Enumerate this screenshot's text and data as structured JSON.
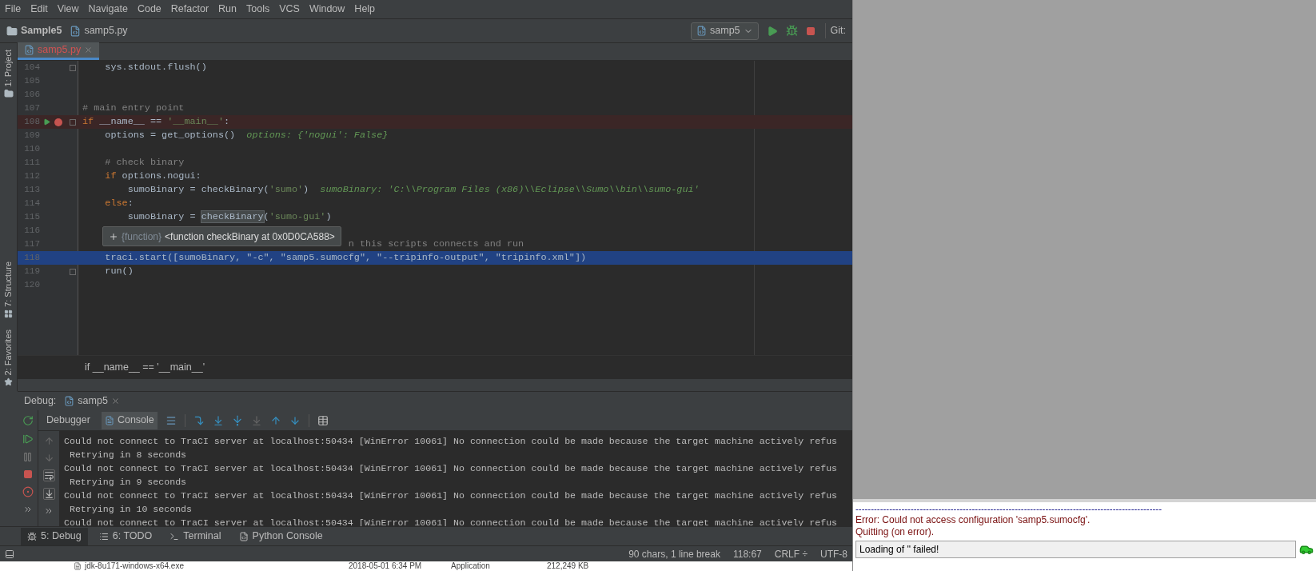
{
  "menu": [
    "File",
    "Edit",
    "View",
    "Navigate",
    "Code",
    "Refactor",
    "Run",
    "Tools",
    "VCS",
    "Window",
    "Help"
  ],
  "breadcrumb": [
    {
      "label": "Sample5",
      "kind": "folder"
    },
    {
      "label": "samp5.py",
      "kind": "file"
    }
  ],
  "run_config": "samp5",
  "toolbar_cut": "Git:",
  "editor_tabs": [
    {
      "label": "samp5.py",
      "selected": true
    }
  ],
  "side_tabs_top": [
    {
      "label": "1: Project",
      "kind": "folder"
    }
  ],
  "side_tabs_bottom": [
    {
      "label": "7: Structure",
      "kind": "structure"
    },
    {
      "label": "2: Favorites",
      "kind": "star"
    }
  ],
  "code_lines": [
    {
      "number": "104",
      "fold": true,
      "breakpoint": false,
      "run_marker": false,
      "selected": false,
      "tokens": [
        {
          "kind": "plain",
          "text": "    sys.stdout.flush()"
        }
      ]
    },
    {
      "number": "105",
      "fold": false,
      "breakpoint": false,
      "run_marker": false,
      "selected": false
    },
    {
      "number": "106",
      "fold": false,
      "breakpoint": false,
      "run_marker": false,
      "selected": false
    },
    {
      "number": "107",
      "fold": false,
      "breakpoint": false,
      "run_marker": false,
      "selected": false,
      "tokens": [
        {
          "kind": "comment",
          "text": "# main entry point"
        }
      ]
    },
    {
      "number": "108",
      "fold": true,
      "breakpoint": true,
      "run_marker": true,
      "selected": false,
      "tokens": [
        {
          "kind": "keyword",
          "text": "if "
        },
        {
          "kind": "plain",
          "text": "__name__ == "
        },
        {
          "kind": "string",
          "text": "'__main__'"
        },
        {
          "kind": "plain",
          "text": ":"
        }
      ]
    },
    {
      "number": "109",
      "fold": false,
      "breakpoint": false,
      "run_marker": false,
      "selected": false,
      "tokens": [
        {
          "kind": "plain",
          "text": "    options = get_options()"
        },
        {
          "kind": "hint",
          "text": "options: {'nogui': False}"
        }
      ]
    },
    {
      "number": "110",
      "fold": false,
      "breakpoint": false,
      "run_marker": false,
      "selected": false
    },
    {
      "number": "111",
      "fold": false,
      "breakpoint": false,
      "run_marker": false,
      "selected": false,
      "tokens": [
        {
          "kind": "comment",
          "text": "    # check binary"
        }
      ]
    },
    {
      "number": "112",
      "fold": false,
      "breakpoint": false,
      "run_marker": false,
      "selected": false,
      "tokens": [
        {
          "kind": "keyword",
          "text": "    if "
        },
        {
          "kind": "plain",
          "text": "options.nogui:"
        }
      ]
    },
    {
      "number": "113",
      "fold": false,
      "breakpoint": false,
      "run_marker": false,
      "selected": false,
      "tokens": [
        {
          "kind": "plain",
          "text": "        sumoBinary = checkBinary("
        },
        {
          "kind": "string",
          "text": "'sumo'"
        },
        {
          "kind": "plain",
          "text": ")"
        },
        {
          "kind": "hint",
          "text": "sumoBinary: 'C:\\\\Program Files (x86)\\\\Eclipse\\\\Sumo\\\\bin\\\\sumo-gui'"
        }
      ]
    },
    {
      "number": "114",
      "fold": false,
      "breakpoint": false,
      "run_marker": false,
      "selected": false,
      "tokens": [
        {
          "kind": "keyword",
          "text": "    else"
        },
        {
          "kind": "plain",
          "text": ":"
        }
      ]
    },
    {
      "number": "115",
      "fold": false,
      "breakpoint": false,
      "run_marker": false,
      "selected": false,
      "tokens": [
        {
          "kind": "plain",
          "text": "        sumoBinary = "
        },
        {
          "kind": "hover",
          "text": "checkBinary"
        },
        {
          "kind": "plain",
          "text": "("
        },
        {
          "kind": "string",
          "text": "'sumo-gui'"
        },
        {
          "kind": "plain",
          "text": ")"
        }
      ]
    },
    {
      "number": "116",
      "fold": false,
      "breakpoint": false,
      "run_marker": false,
      "selected": false
    },
    {
      "number": "117",
      "fold": false,
      "breakpoint": false,
      "run_marker": false,
      "selected": false,
      "tokens": [
        {
          "kind": "covered_comment",
          "text": "n this scripts connects and run"
        }
      ]
    },
    {
      "number": "118",
      "fold": false,
      "breakpoint": false,
      "run_marker": false,
      "selected": true,
      "tokens": [
        {
          "kind": "plain",
          "text": "    traci.start([sumoBinary, \"-c\", \"samp5.sumocfg\", \"--tripinfo-output\", \"tripinfo.xml\"])"
        }
      ]
    },
    {
      "number": "119",
      "fold": true,
      "breakpoint": false,
      "run_marker": false,
      "selected": false,
      "tokens": [
        {
          "kind": "plain",
          "text": "    run()"
        }
      ]
    },
    {
      "number": "120",
      "fold": false,
      "breakpoint": false,
      "run_marker": false,
      "selected": false
    }
  ],
  "tooltip": {
    "type": "{function}",
    "value": "<function checkBinary at 0x0D0CA588>"
  },
  "breadcrumb_path": "if __name__ == '__main__'",
  "debug": {
    "title": "Debug:",
    "session": "samp5",
    "tabs": [
      {
        "label": "Debugger",
        "selected": false
      },
      {
        "label": "Console",
        "selected": true
      }
    ],
    "console": [
      "Could not connect to TraCI server at localhost:50434 [WinError 10061] No connection could be made because the target machine actively refus",
      " Retrying in 8 seconds",
      "Could not connect to TraCI server at localhost:50434 [WinError 10061] No connection could be made because the target machine actively refus",
      " Retrying in 9 seconds",
      "Could not connect to TraCI server at localhost:50434 [WinError 10061] No connection could be made because the target machine actively refus",
      " Retrying in 10 seconds",
      "Could not connect to TraCI server at localhost:50434 [WinError 10061] No connection could be made because the target machine actively refus"
    ]
  },
  "tool_tabs": [
    {
      "label": "5: Debug",
      "kind": "bug",
      "selected": true
    },
    {
      "label": "6: TODO",
      "kind": "list",
      "selected": false
    },
    {
      "label": "Terminal",
      "kind": "terminal",
      "selected": false
    },
    {
      "label": "Python Console",
      "kind": "python",
      "selected": false
    }
  ],
  "status": [
    "90 chars, 1 line break",
    "118:67",
    "CRLF ÷",
    "UTF-8"
  ],
  "explorer_row": [
    "jdk-8u171-windows-x64.exe",
    "2018-05-01 6:34 PM",
    "Application",
    "212,249 KB"
  ],
  "sumo": {
    "separator": "----------------------------------------------------------------------------------------------------",
    "messages": [
      "Error: Could not access configuration 'samp5.sumocfg'.",
      "Quitting (on error)."
    ],
    "status": "Loading of '' failed!"
  }
}
